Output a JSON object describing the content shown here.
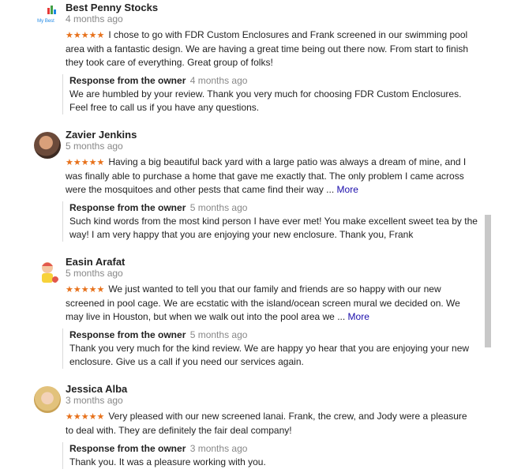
{
  "reviews": [
    {
      "name": "Best Penny Stocks",
      "time": "4 months ago",
      "stars": "★★★★★",
      "text": "I chose to go with FDR Custom Enclosures and Frank screened in our swimming pool area with a fantastic design. We are having a great time being out there now. From start to finish they took care of everything. Great group of folks!",
      "more": "",
      "owner_label": "Response from the owner",
      "owner_time": "4 months ago",
      "owner_text": "We are humbled by your review. Thank you very much for choosing FDR Custom Enclosures. Feel free to call us if you have any questions.",
      "avatar_text": "My Best"
    },
    {
      "name": "Zavier Jenkins",
      "time": "5 months ago",
      "stars": "★★★★★",
      "text": "Having a big beautiful back yard with a large patio was always a dream of mine, and I was finally able to purchase a home that gave me exactly that. The only problem I came across were the mosquitoes and other pests that came find their way ...",
      "more": "More",
      "owner_label": "Response from the owner",
      "owner_time": "5 months ago",
      "owner_text": "Such kind words from the most kind person I have ever met! You make excellent sweet tea by the way! I am very happy that you are enjoying your new enclosure. Thank you, Frank"
    },
    {
      "name": "Easin Arafat",
      "time": "5 months ago",
      "stars": "★★★★★",
      "text": "We just wanted to tell you that our family and friends are so happy with our new screened in pool cage. We are ecstatic with the island/ocean screen mural we decided on. We may live in Houston, but when we walk out into the pool area we ...",
      "more": "More",
      "owner_label": "Response from the owner",
      "owner_time": "5 months ago",
      "owner_text": "Thank you very much for the kind review. We are happy yo hear that you are enjoying your new enclosure. Give us a call if you need our services again."
    },
    {
      "name": "Jessica Alba",
      "time": "3 months ago",
      "stars": "★★★★★",
      "text": "Very pleased with our new screened lanai. Frank, the crew, and Jody were a pleasure to deal with. They are definitely the fair deal company!",
      "more": "",
      "owner_label": "Response from the owner",
      "owner_time": "3 months ago",
      "owner_text": "Thank you. It was a pleasure working with you."
    }
  ],
  "colors": {
    "star": "#e7711b",
    "link": "#1a0dab",
    "muted": "#888888"
  }
}
